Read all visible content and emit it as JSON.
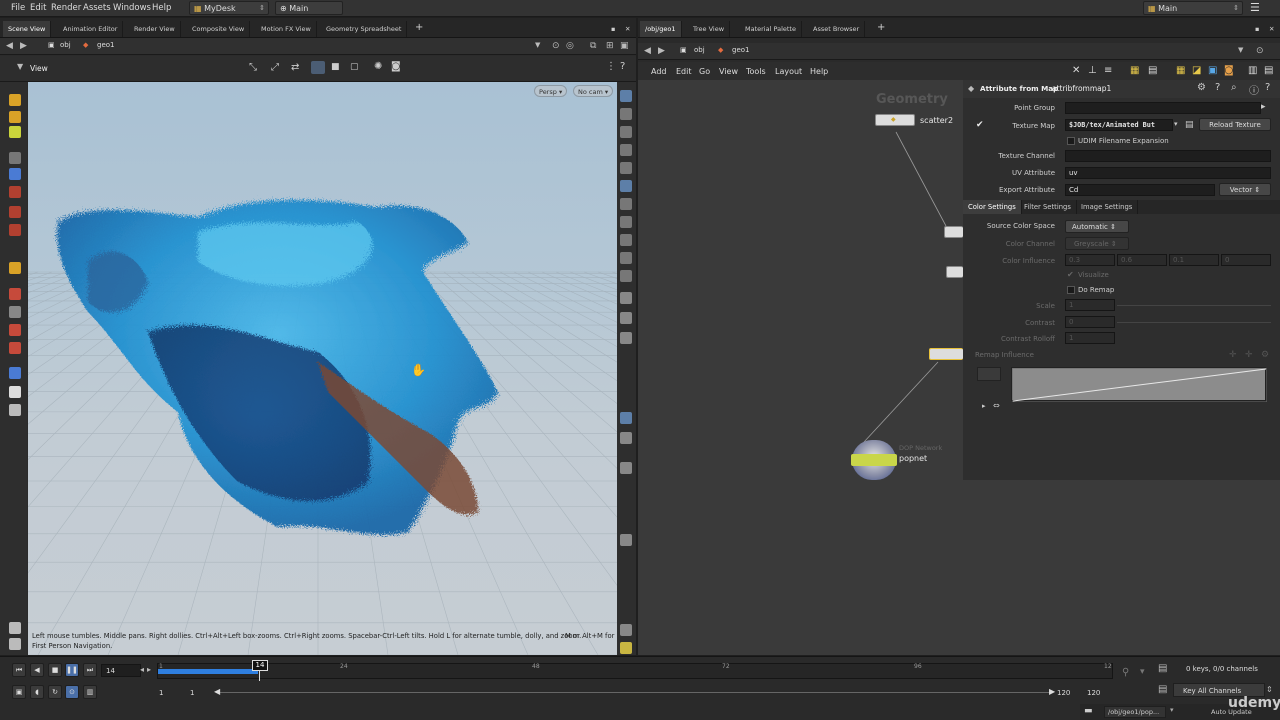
{
  "menubar": {
    "items": [
      "File",
      "Edit",
      "Render",
      "Assets",
      "Windows",
      "Help"
    ],
    "desktop": "MyDesk",
    "main": "Main",
    "main_right": "Main"
  },
  "left_pane": {
    "tabs": [
      "Scene View",
      "Animation Editor",
      "Render View",
      "Composite View",
      "Motion FX View",
      "Geometry Spreadsheet"
    ],
    "path": {
      "obj": "obj",
      "geo": "geo1"
    },
    "view_label": "View",
    "persp": "Persp",
    "cam": "No cam",
    "hint_line1": "Left mouse tumbles. Middle pans. Right dollies. Ctrl+Alt+Left box-zooms. Ctrl+Right zooms. Spacebar-Ctrl-Left tilts. Hold L for alternate tumble, dolly, and zoom.",
    "hint_right": "M or Alt+M for",
    "hint_line2": "First Person Navigation."
  },
  "right_pane": {
    "tabs": [
      "/obj/geo1",
      "Tree View",
      "Material Palette",
      "Asset Browser"
    ],
    "path": {
      "obj": "obj",
      "geo": "geo1"
    },
    "menu": [
      "Add",
      "Edit",
      "Go",
      "View",
      "Tools",
      "Layout",
      "Help"
    ],
    "network_title": "Geometry",
    "nodes": {
      "scatter": "scatter2",
      "popnet_type": "DOP Network",
      "popnet": "popnet"
    }
  },
  "params": {
    "node_type": "Attribute from Map",
    "node_name": "attribfrommap1",
    "point_group_label": "Point Group",
    "point_group_value": "",
    "texture_map_label": "Texture Map",
    "texture_map_value": "$JOB/tex/Animated But",
    "reload_button": "Reload Texture",
    "udim_label": "UDIM Filename Expansion",
    "texture_channel_label": "Texture Channel",
    "texture_channel_value": "",
    "uv_label": "UV Attribute",
    "uv_value": "uv",
    "export_label": "Export Attribute",
    "export_value": "Cd",
    "export_type": "Vector",
    "tabs": [
      "Color Settings",
      "Filter Settings",
      "Image Settings"
    ],
    "source_cs_label": "Source Color Space",
    "source_cs_value": "Automatic",
    "color_channel_label": "Color Channel",
    "color_channel_value": "Greyscale",
    "color_influence_label": "Color Influence",
    "color_influence_values": [
      "0.3",
      "0.6",
      "0.1",
      "0"
    ],
    "visualize_label": "Visualize",
    "do_remap_label": "Do Remap",
    "scale_label": "Scale",
    "scale_value": "1",
    "contrast_label": "Contrast",
    "contrast_value": "0",
    "contrast_rolloff_label": "Contrast Rolloff",
    "contrast_rolloff_value": "1",
    "remap_label": "Remap Influence"
  },
  "timeline": {
    "current_frame": "14",
    "frame_marker": "14",
    "ticks": [
      "1",
      "24",
      "48",
      "72",
      "96",
      "12"
    ],
    "start": "1",
    "start2": "1",
    "end": "120",
    "end2": "120",
    "keys": "0 keys, 0/0 channels",
    "key_all": "Key All Channels",
    "status_path": "/obj/geo1/pop...",
    "auto_update": "Auto Update"
  },
  "watermark": "udemy",
  "colors": {
    "accent": "#2f7fe0",
    "node_highlight": "#e8c23a",
    "viewport_top": "#a9c1d4"
  }
}
